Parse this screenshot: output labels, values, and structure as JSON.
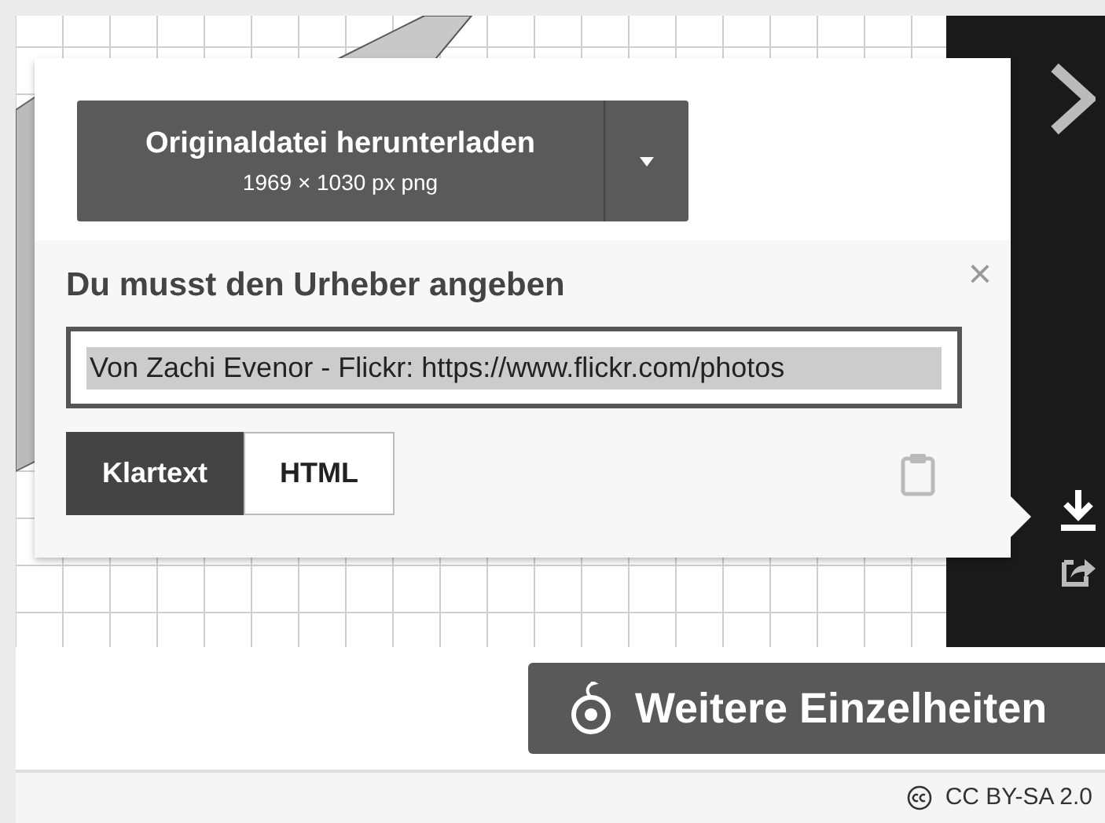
{
  "download": {
    "label": "Originaldatei herunterladen",
    "details": "1969 × 1030 px png"
  },
  "attribution": {
    "title": "Du musst den Urheber angeben",
    "close": "×",
    "value": "Von Zachi Evenor - Flickr: https://www.flickr.com/photos",
    "formats": [
      {
        "label": "Klartext",
        "selected": true
      },
      {
        "label": "HTML",
        "selected": false
      }
    ]
  },
  "details_button": "Weitere Einzelheiten",
  "license": "CC BY-SA 2.0"
}
